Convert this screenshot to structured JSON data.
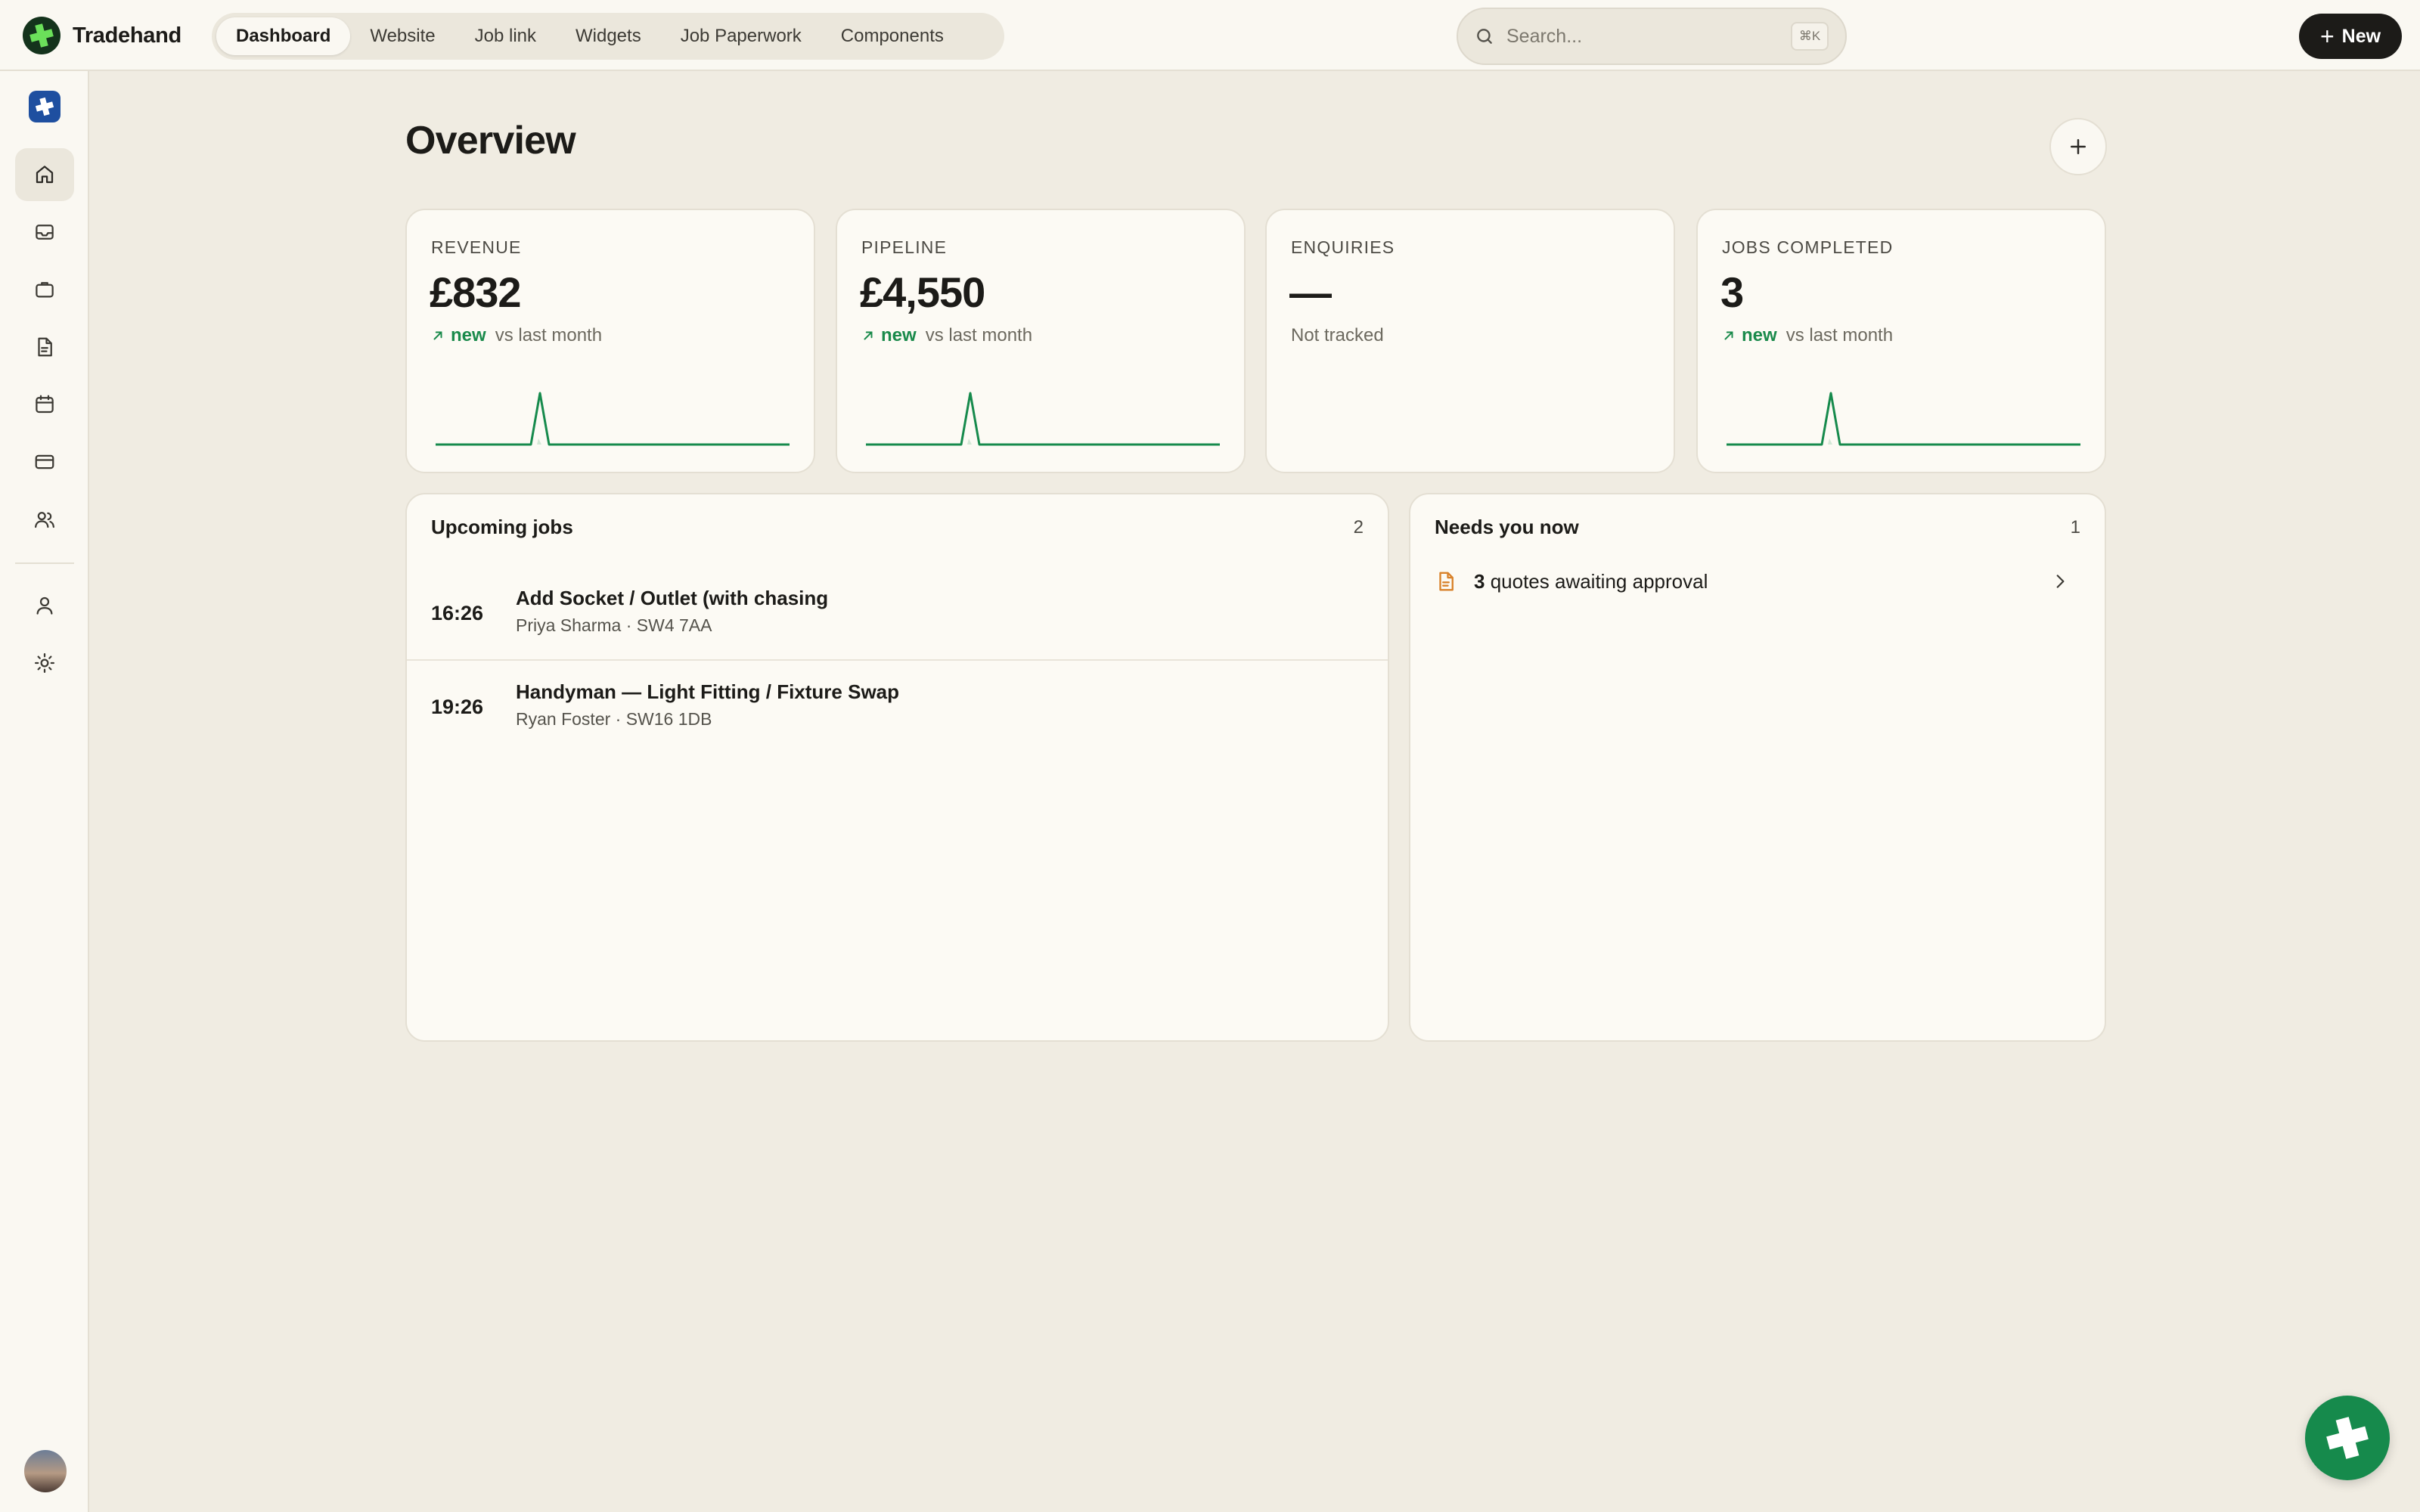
{
  "app": {
    "name": "Tradehand"
  },
  "nav": {
    "tabs": [
      {
        "label": "Dashboard",
        "active": true
      },
      {
        "label": "Website"
      },
      {
        "label": "Job link"
      },
      {
        "label": "Widgets"
      },
      {
        "label": "Job Paperwork"
      },
      {
        "label": "Components"
      }
    ]
  },
  "search": {
    "placeholder": "Search...",
    "shortcut": "⌘K"
  },
  "new_button": {
    "label": "New"
  },
  "sidebar": {
    "items": [
      {
        "icon": "home-icon",
        "active": true
      },
      {
        "icon": "inbox-icon"
      },
      {
        "icon": "briefcase-icon"
      },
      {
        "icon": "document-icon"
      },
      {
        "icon": "calendar-icon"
      },
      {
        "icon": "credit-card-icon"
      },
      {
        "icon": "users-icon"
      },
      {
        "icon": "user-icon"
      },
      {
        "icon": "settings-icon"
      }
    ]
  },
  "page": {
    "title": "Overview"
  },
  "stats": [
    {
      "label": "REVENUE",
      "value": "£832",
      "trend": "new",
      "compare": "vs last month",
      "has_spark": true
    },
    {
      "label": "PIPELINE",
      "value": "£4,550",
      "trend": "new",
      "compare": "vs last month",
      "has_spark": true
    },
    {
      "label": "ENQUIRIES",
      "value": "—",
      "note": "Not tracked",
      "has_spark": false
    },
    {
      "label": "JOBS COMPLETED",
      "value": "3",
      "trend": "new",
      "compare": "vs last month",
      "has_spark": true
    }
  ],
  "upcoming_jobs": {
    "title": "Upcoming jobs",
    "count": "2",
    "items": [
      {
        "time": "16:26",
        "title": "Add Socket / Outlet (with chasing",
        "meta": "Priya Sharma · SW4 7AA"
      },
      {
        "time": "19:26",
        "title": "Handyman — Light Fitting / Fixture Swap",
        "meta": "Ryan Foster · SW16 1DB"
      }
    ]
  },
  "needs_you_now": {
    "title": "Needs you now",
    "count": "1",
    "items": [
      {
        "count": "3",
        "text": "quotes awaiting approval"
      }
    ]
  },
  "colors": {
    "accent_green": "#168a4c",
    "warning_orange": "#d9822b",
    "brand_blue": "#1e4fa0"
  }
}
